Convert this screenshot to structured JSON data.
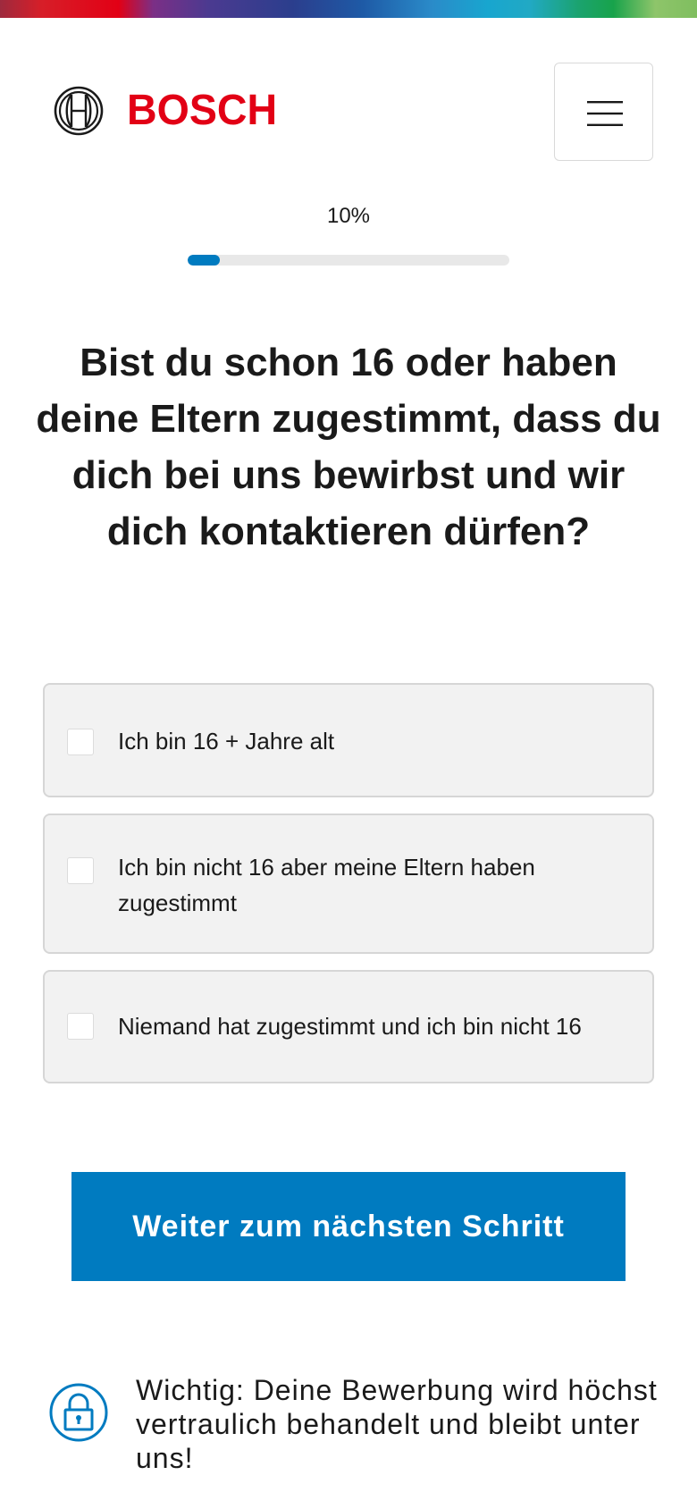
{
  "brand": {
    "name": "BOSCH",
    "logo_icon": "bosch-armature-icon",
    "color": "#e20015"
  },
  "header": {
    "menu_icon": "hamburger-menu-icon"
  },
  "progress": {
    "label": "10%",
    "value": 0.1,
    "color": "#007bc0"
  },
  "question": {
    "title": "Bist du schon 16 oder haben deine Eltern zugestimmt, dass du dich bei uns bewirbst und wir dich kontaktieren dürfen?"
  },
  "options": [
    {
      "label": "Ich bin 16 + Jahre alt",
      "checked": false
    },
    {
      "label": "Ich bin nicht 16 aber meine Eltern haben zugestimmt",
      "checked": false
    },
    {
      "label": "Niemand hat zugestimmt und ich bin nicht 16",
      "checked": false
    }
  ],
  "cta": {
    "label": "Weiter zum nächsten Schritt",
    "color": "#007bc0"
  },
  "notice": {
    "icon": "lock-icon",
    "text": "Wichtig: Deine Bewerbung wird höchst vertraulich behandelt und bleibt unter uns!"
  }
}
